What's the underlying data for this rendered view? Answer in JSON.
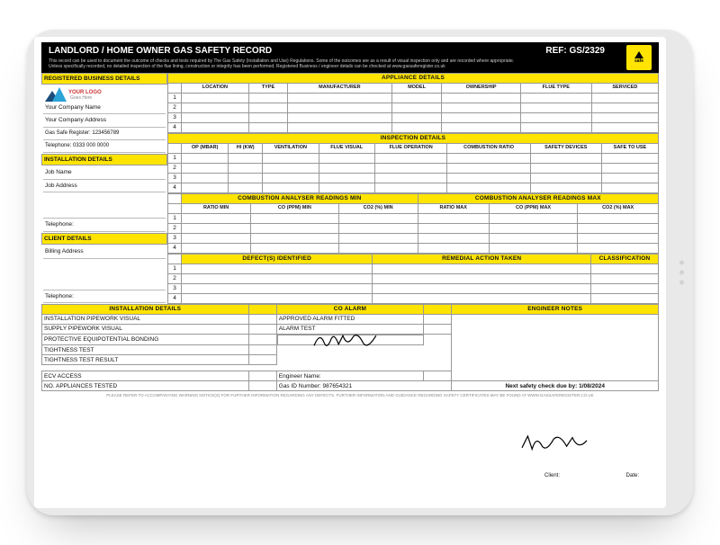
{
  "header": {
    "title": "LANDLORD / HOME OWNER GAS SAFETY RECORD",
    "ref_label": "REF:",
    "ref_value": "GS/2329",
    "subtext": "This record can be used to document the outcome of checks and tests required by The Gas Safety (Installation and Use) Regulations. Some of the outcomes are as a result of visual inspection only and are recorded where appropriate. Unless specifically recorded, no detailed inspection of the flue lining, construction or integrity has been performed. Registered Business / engineer details can be checked at www.gassaferegister.co.uk",
    "gas_safe_logo": "safe"
  },
  "left": {
    "reg_header": "REGISTERED BUSINESS DETAILS",
    "logo_line1": "YOUR LOGO",
    "logo_line2": "Goes Here",
    "company_name": "Your Company Name",
    "company_address": "Your Company Address",
    "gas_safe_reg": "Gas Safe Register: 123456789",
    "telephone1": "Telephone: 0333 000 0000",
    "install_header": "INSTALLATION DETAILS",
    "job_name": "Job Name",
    "job_address": "Job Address",
    "telephone2": "Telephone:",
    "client_header": "CLIENT DETAILS",
    "billing": "Billing Address",
    "telephone3": "Telephone:"
  },
  "appliance": {
    "section": "APPLIANCE DETAILS",
    "cols": {
      "location": "LOCATION",
      "type": "TYPE",
      "manufacturer": "MANUFACTURER",
      "model": "MODEL",
      "ownership": "OWNERSHIP",
      "flue_type": "FLUE TYPE",
      "serviced": "SERVICED"
    },
    "rows": [
      "1",
      "2",
      "3",
      "4"
    ]
  },
  "inspection": {
    "section": "INSPECTION DETAILS",
    "cols": {
      "op": "OP (MBAR)",
      "hi": "HI (KW)",
      "vent": "VENTILATION",
      "flue_visual": "FLUE VISUAL",
      "flue_op": "FLUE OPERATION",
      "comb": "COMBUSTION RATIO",
      "safety": "SAFETY DEVICES",
      "safe": "SAFE TO USE"
    },
    "rows": [
      "1",
      "2",
      "3",
      "4"
    ]
  },
  "analyser": {
    "min_section": "COMBUSTION ANALYSER READINGS MIN",
    "max_section": "COMBUSTION ANALYSER READINGS MAX",
    "min_cols": {
      "ratio": "RATIO MIN",
      "co": "CO (PPM) MIN",
      "co2": "CO2 (%) MIN"
    },
    "max_cols": {
      "ratio": "RATIO MAX",
      "co": "CO (PPM) MAX",
      "co2": "CO2 (%) MAX"
    },
    "rows": [
      "1",
      "2",
      "3",
      "4"
    ]
  },
  "defects": {
    "defect_section": "DEFECT(S) IDENTIFIED",
    "remedial_section": "REMEDIAL ACTION TAKEN",
    "class_section": "CLASSIFICATION",
    "rows": [
      "1",
      "2",
      "3",
      "4"
    ]
  },
  "bottom": {
    "install": {
      "section": "INSTALLATION DETAILS",
      "rows": {
        "r1": "INSTALLATION PIPEWORK VISUAL",
        "r2": "SUPPLY PIPEWORK VISUAL",
        "r3": "PROTECTIVE EQUIPOTENTIAL BONDING",
        "r4": "TIGHTNESS TEST",
        "r5": "TIGHTNESS TEST RESULT",
        "r6": "ECV ACCESS",
        "r7": "NO. APPLIANCES TESTED"
      }
    },
    "coalarm": {
      "section": "CO ALARM",
      "rows": {
        "r1": "APPROVED ALARM FITTED",
        "r2": "ALARM TEST"
      }
    },
    "engineer_notes": "ENGINEER NOTES",
    "sig_left": {
      "label1": "Engineer Name:",
      "label2": "Gas ID Number: 987654321"
    },
    "sig_right": {
      "label1": "Client:",
      "label2": "Date:",
      "next": "Next safety check due by: 1/08/2024"
    }
  },
  "footer": "PLEASE REFER TO ACCOMPANYING WARNING NOTICE(S) FOR FURTHER INFORMATION REGARDING ANY DEFECTS. FURTHER INFORMATION AND GUIDANCE REGARDING SAFETY CERTIFICATES MAY BE FOUND AT WWW.GASSAFEREGISTER.CO.UK"
}
